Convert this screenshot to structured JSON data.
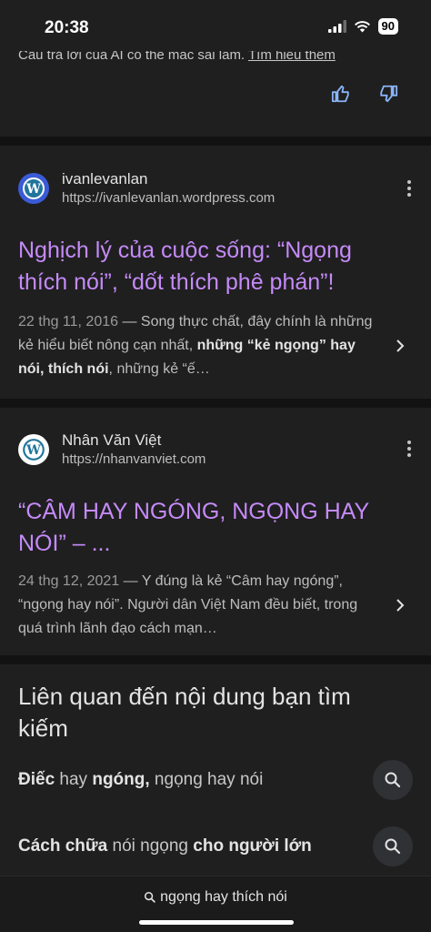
{
  "status": {
    "time": "20:38",
    "battery": "90"
  },
  "ai_note": {
    "text": "Câu trả lời của AI có thể mắc sai lầm.",
    "link": "Tìm hiểu thêm"
  },
  "results": [
    {
      "site_name": "ivanlevanlan",
      "url": "https://ivanlevanlan.wordpress.com",
      "title": "Nghịch lý của cuộc sống: “Ngọng thích nói”, “dốt thích phê phán”!",
      "date": "22 thg 11, 2016",
      "snippet_parts": [
        " — Song thực chất, đây chính là những kẻ hiểu biết nông cạn nhất, ",
        "những “kẻ ngọng” hay nói, thích nói",
        ", những kẻ “ế…"
      ]
    },
    {
      "site_name": "Nhân Văn Việt",
      "url": "https://nhanvanviet.com",
      "title": "“CÂM HAY NGÓNG, NGỌNG HAY NÓI” – ...",
      "date": "24 thg 12, 2021",
      "snippet_parts": [
        " — Y đúng là kẻ “Câm hay ngóng”, “ngọng hay nói”. Người dân Việt Nam đều biết, trong quá trình lãnh đạo cách mạn…"
      ]
    }
  ],
  "related": {
    "title": "Liên quan đến nội dung bạn tìm kiếm",
    "items": [
      {
        "parts": [
          {
            "t": "Điếc",
            "b": true
          },
          {
            "t": " hay ",
            "b": false
          },
          {
            "t": "ngóng,",
            "b": true
          },
          {
            "t": " ngọng hay nói",
            "b": false
          }
        ]
      },
      {
        "parts": [
          {
            "t": "Cách chữa",
            "b": true
          },
          {
            "t": " nói ngọng ",
            "b": false
          },
          {
            "t": "cho người lớn",
            "b": true
          }
        ]
      }
    ]
  },
  "bottom": {
    "query": "ngọng hay thích nói"
  },
  "icons": {
    "favicon": "wordpress-icon",
    "more": "more-vert-icon",
    "chevron": "chevron-right-icon",
    "search": "search-icon",
    "thumbs_up": "thumbs-up-icon",
    "thumbs_down": "thumbs-down-icon"
  },
  "colors": {
    "title_link": "#c58af9",
    "background": "#1f1f1f",
    "favicon_blue_1": "#3b5bd6",
    "favicon_blue_2": "#21759b"
  }
}
